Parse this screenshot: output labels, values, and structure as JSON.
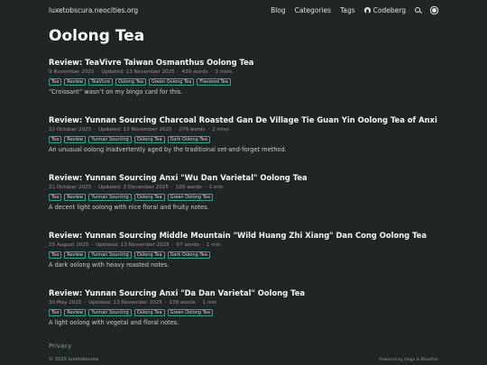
{
  "header": {
    "site_name": "luxetobscura.neocities.org",
    "nav": {
      "blog": "Blog",
      "categories": "Categories",
      "tags": "Tags",
      "codeberg": "Codeberg"
    },
    "icons": [
      "codeberg-icon",
      "search-icon",
      "theme-toggle-icon"
    ]
  },
  "page_title": "Oolong Tea",
  "posts": [
    {
      "title": "Review: TeaVivre Taiwan Osmanthus Oolong Tea",
      "date": "9 November 2025",
      "updated": "Updated: 13 November 2025",
      "words": "430 words",
      "read_time": "3 mins",
      "tags": [
        "Tea",
        "Review",
        "TeaVivre",
        "Oolong Tea",
        "Green Oolong Tea",
        "Flavored Tea"
      ],
      "summary": "“Croissant” wasn’t on my bingo card for this."
    },
    {
      "title": "Review: Yunnan Sourcing Charcoal Roasted Gan De Village Tie Guan Yin Oolong Tea of Anxi",
      "date": "22 October 2025",
      "updated": "Updated: 13 November 2025",
      "words": "276 words",
      "read_time": "2 mins",
      "tags": [
        "Tea",
        "Review",
        "Yunnan Sourcing",
        "Oolong Tea",
        "Dark Oolong Tea"
      ],
      "summary": "An unusual oolong inadvertently aged by the traditional set-and-forget method."
    },
    {
      "title": "Review: Yunnan Sourcing Anxi \"Wu Dan Varietal\" Oolong Tea",
      "date": "21 October 2025",
      "updated": "Updated: 3 December 2025",
      "words": "189 words",
      "read_time": "1 min",
      "tags": [
        "Tea",
        "Review",
        "Yunnan Sourcing",
        "Oolong Tea",
        "Green Oolong Tea"
      ],
      "summary": "A decent light oolong with nice floral and fruity notes."
    },
    {
      "title": "Review: Yunnan Sourcing Middle Mountain \"Wild Huang Zhi Xiang\" Dan Cong Oolong Tea",
      "date": "25 August 2025",
      "updated": "Updated: 13 November 2025",
      "words": "97 words",
      "read_time": "1 min",
      "tags": [
        "Tea",
        "Review",
        "Yunnan Sourcing",
        "Oolong Tea",
        "Dark Oolong Tea"
      ],
      "summary": "A dark oolong with heavy roasted notes."
    },
    {
      "title": "Review: Yunnan Sourcing Anxi \"Da Dan Varietal\" Oolong Tea",
      "date": "30 May 2025",
      "updated": "Updated: 13 November 2025",
      "words": "139 words",
      "read_time": "1 min",
      "tags": [
        "Tea",
        "Review",
        "Yunnan Sourcing",
        "Oolong Tea",
        "Green Oolong Tea"
      ],
      "summary": "A light oolong with vegetal and floral notes."
    }
  ],
  "footer": {
    "privacy": "Privacy",
    "copyright": "© 2025 luxetobscura",
    "powered_by": "Powered by Hugo & Blowfish"
  },
  "colors": {
    "background": "#1f2625",
    "tag_border": "#3aa796",
    "title_text": "#ffffff",
    "muted_text": "#8e9794"
  }
}
